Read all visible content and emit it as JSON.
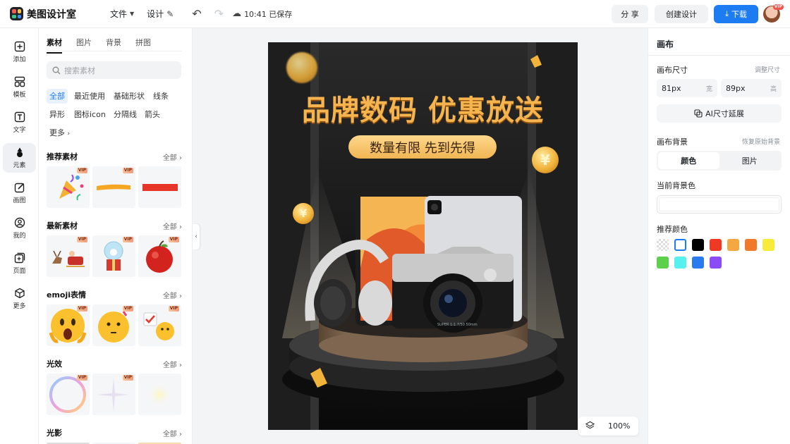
{
  "app": {
    "name": "美图设计室"
  },
  "topbar": {
    "menu_file": "文件",
    "menu_design": "设计",
    "saved_status": "10:41 已保存",
    "share_label": "分 享",
    "create_label": "创建设计",
    "download_label": "下载",
    "avatar_badge": "VIP"
  },
  "leftnav": {
    "items": [
      {
        "label": "添加",
        "icon": "plus-square-icon"
      },
      {
        "label": "模板",
        "icon": "template-icon"
      },
      {
        "label": "文字",
        "icon": "text-icon"
      },
      {
        "label": "元素",
        "icon": "shapes-icon"
      },
      {
        "label": "画图",
        "icon": "draw-icon"
      },
      {
        "label": "我的",
        "icon": "user-icon"
      },
      {
        "label": "页面",
        "icon": "page-icon"
      },
      {
        "label": "更多",
        "icon": "cube-icon"
      }
    ],
    "active_index": 3
  },
  "panel": {
    "tabs": [
      "素材",
      "图片",
      "背景",
      "拼图"
    ],
    "search_placeholder": "搜索素材",
    "chips": [
      "全部",
      "最近使用",
      "基础形状",
      "线条",
      "异形",
      "图标icon",
      "分隔线",
      "箭头",
      "更多"
    ],
    "sections": [
      {
        "title": "推荐素材",
        "all": "全部"
      },
      {
        "title": "最新素材",
        "all": "全部"
      },
      {
        "title": "emoji表情",
        "all": "全部"
      },
      {
        "title": "光效",
        "all": "全部"
      },
      {
        "title": "光影",
        "all": "全部"
      }
    ],
    "vip_badge": "VIP"
  },
  "canvas": {
    "headline": "品牌数码 优惠放送",
    "subline": "数量有限 先到先得",
    "coin_symbol": "¥",
    "camera_text": "SUPER 1:1.7/50 50mm",
    "accent": "#f5b44d",
    "background": "#111111"
  },
  "right": {
    "title": "画布",
    "size_label": "画布尺寸",
    "size_hint": "调整尺寸",
    "width_value": "81px",
    "width_unit": "宽",
    "height_value": "89px",
    "height_unit": "高",
    "ai_button": "AI尺寸延展",
    "bg_label": "画布背景",
    "bg_hint": "恢复原始背景",
    "seg_color": "颜色",
    "seg_image": "图片",
    "current_color_label": "当前背景色",
    "recommend_label": "推荐颜色",
    "swatches": [
      "transparent",
      "#ffffff",
      "#000000",
      "#ee3a24",
      "#f5a742",
      "#f07a2a",
      "#f7ec3c",
      "#5bd04a",
      "#56f0ee",
      "#2a7af0",
      "#8a4cf5"
    ]
  },
  "zoom": {
    "value": "100%"
  },
  "colors": {
    "brand_blue": "#1e7cf2",
    "active_chip_bg": "#e8f1fe"
  }
}
